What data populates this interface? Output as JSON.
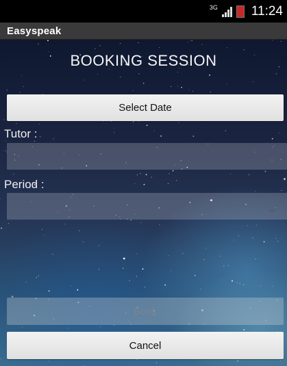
{
  "status_bar": {
    "network": "3G",
    "time": "11:24",
    "battery_color": "#c62828"
  },
  "action_bar": {
    "app_name": "Easyspeak"
  },
  "form": {
    "title": "BOOKING SESSION",
    "select_date_label": "Select Date",
    "tutor_label": "Tutor :",
    "tutor_value": "",
    "period_label": "Period :",
    "period_value": "",
    "book_label": "Book",
    "cancel_label": "Cancel"
  }
}
